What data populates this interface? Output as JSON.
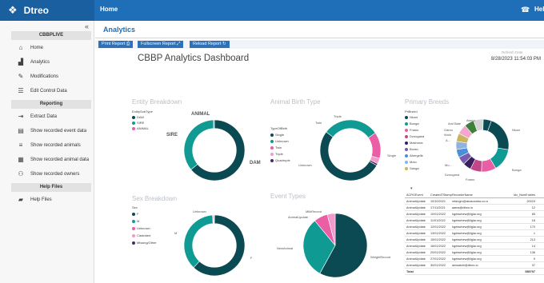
{
  "topbar": {
    "brand": "Dtreo",
    "home": "Home",
    "user": "Hel"
  },
  "sidebar": {
    "section1": "CBBPLIVE",
    "items1": [
      {
        "label": "Home",
        "icon": "home-icon"
      },
      {
        "label": "Analytics",
        "icon": "analytics-icon"
      },
      {
        "label": "Modifications",
        "icon": "edit-icon"
      },
      {
        "label": "Edit Control Data",
        "icon": "list-icon"
      }
    ],
    "section2": "Reporting",
    "items2": [
      {
        "label": "Extract Data",
        "icon": "extract-icon"
      },
      {
        "label": "Show recorded event data",
        "icon": "event-icon"
      },
      {
        "label": "Show recorded animals",
        "icon": "animals-icon"
      },
      {
        "label": "Show recorded animal data",
        "icon": "table-icon"
      },
      {
        "label": "Show recorded owners",
        "icon": "owners-icon"
      }
    ],
    "section3": "Help Files",
    "items3": [
      {
        "label": "Help Files",
        "icon": "folder-icon"
      }
    ]
  },
  "main": {
    "analytics": "Analytics",
    "buttons": [
      "Print Report",
      "Fullscreen Report",
      "Reload Report"
    ],
    "title": "CBBP Analytics Dashboard",
    "refresh_label": "Refresh Date",
    "refresh_date": "8/28/2023 11:54:03 PM"
  },
  "panels": {
    "entity": {
      "title": "Entity Breakdown",
      "legend_title": "EntitySubType",
      "legend": [
        "DAM",
        "SIRE",
        "ANIMAL"
      ],
      "labels": [
        "ANIMAL",
        "SIRE",
        "DAM"
      ],
      "colors": [
        "#0b4a52",
        "#0f9a94",
        "#ea5ea5"
      ]
    },
    "birth": {
      "title": "Animal Birth Type",
      "legend_title": "TypeOfBirth",
      "legend": [
        "Single",
        "Unknown",
        "Twin",
        "Triple",
        "Quadruple"
      ],
      "labels": [
        "Twin",
        "Triple",
        "Single",
        "Unknown"
      ],
      "colors": [
        "#0b4a52",
        "#0f9a94",
        "#ea5ea5",
        "#f29ac9",
        "#4a2a6a"
      ]
    },
    "breeds": {
      "title": "Primary Breeds",
      "legend_title": "PriBreed",
      "legend": [
        "Nkoni",
        "Bonga",
        "Fnanu",
        "Dzoogana",
        "Mashona",
        "Boran",
        "Abergelle",
        "Molo",
        "Sanga"
      ],
      "labels": [
        "Abera",
        "Arsi Bale",
        "Gamu",
        "Wolo",
        "A...",
        "Mo...",
        "Dzoogana",
        "Fnanu",
        "Bonga",
        "Nkoni"
      ],
      "colors": [
        "#0b4a52",
        "#0f9a94",
        "#ea5ea5",
        "#c2478a",
        "#3a1f5c",
        "#7b5bb0",
        "#4a90d9",
        "#8fb2e0",
        "#c9b65a",
        "#f2a7cf",
        "#3d7f3d",
        "#d4d4d4"
      ]
    },
    "sex": {
      "title": "Sex Breakdown",
      "legend_title": "Sex",
      "legend": [
        "F",
        "M",
        "Unknown",
        "Castrated",
        "Missing/Other"
      ],
      "labels": [
        "Unknown",
        "M",
        "F"
      ],
      "colors": [
        "#0b4a52",
        "#0f9a94",
        "#ea5ea5",
        "#f29ac9",
        "#4a2a6a"
      ]
    },
    "events": {
      "title": "Event Types",
      "labels": [
        "MilkRecord",
        "AnimalUpdate",
        "NewAnimal",
        "WeightRecord"
      ],
      "colors": [
        "#0b4a52",
        "#0f9a94",
        "#ea5ea5",
        "#f29ac9",
        "#4a2a6a",
        "#c9b65a"
      ]
    }
  },
  "table": {
    "headers": [
      "ACRGEvent",
      "CreatedTStamp",
      "RecorderName",
      "Idx_NumEntries"
    ],
    "rows": [
      [
        "AnimalUpdate",
        "10/10/2021",
        "mfangm@akasucaba.co.rz",
        "20023"
      ],
      [
        "AnimalUpdate",
        "17/11/2021",
        "aama@dtreo.io",
        "12"
      ],
      [
        "AnimalUpdate",
        "10/01/2022",
        "hgetachew@ilgiar.org",
        "65"
      ],
      [
        "AnimalUpdate",
        "11/01/2022",
        "hgetachew@ilgiar.org",
        "18"
      ],
      [
        "AnimalUpdate",
        "12/01/2022",
        "hgetachew@ilgiar.org",
        "170"
      ],
      [
        "AnimalUpdate",
        "13/01/2022",
        "hgetachew@ilgiar.org",
        "1"
      ],
      [
        "AnimalUpdate",
        "15/01/2022",
        "hgetachew@ilgiar.org",
        "213"
      ],
      [
        "AnimalUpdate",
        "16/01/2022",
        "hgetachew@ilgiar.org",
        "14"
      ],
      [
        "AnimalUpdate",
        "20/01/2022",
        "hgetachew@ilgiar.org",
        "136"
      ],
      [
        "AnimalUpdate",
        "27/01/2022",
        "hgetachew@ilgiar.org",
        "9"
      ],
      [
        "AnimalUpdate",
        "30/01/2022",
        "amwatchi@dtreo.io",
        "37"
      ]
    ],
    "total_label": "Total",
    "total_value": "585797"
  },
  "chart_data": [
    {
      "type": "pie",
      "title": "Entity Breakdown",
      "labels": [
        "DAM",
        "SIRE",
        "ANIMAL"
      ],
      "values": [
        64,
        35.5,
        0.5
      ]
    },
    {
      "type": "pie",
      "title": "Animal Birth Type",
      "labels": [
        "Single",
        "Unknown",
        "Twin",
        "Triple",
        "Quadruple"
      ],
      "values": [
        52,
        30,
        14,
        3,
        1
      ]
    },
    {
      "type": "pie",
      "title": "Primary Breeds",
      "labels": [
        "Nkoni",
        "Bonga",
        "Fnanu",
        "Dzoogana",
        "Mashona",
        "Boran",
        "Abergelle",
        "Mo...",
        "A...",
        "Wolo",
        "Gamu",
        "Arsi Bale",
        "Abera"
      ],
      "values": [
        22,
        14,
        9,
        7,
        5,
        5,
        5,
        5,
        5,
        6,
        6,
        6,
        5
      ]
    },
    {
      "type": "pie",
      "title": "Sex Breakdown",
      "labels": [
        "F",
        "M",
        "Unknown",
        "Castrated",
        "Missing/Other"
      ],
      "values": [
        62,
        37,
        0.5,
        0.3,
        0.2
      ]
    },
    {
      "type": "pie",
      "title": "Event Types",
      "labels": [
        "WeightRecord",
        "NewAnimal",
        "AnimalUpdate",
        "MilkRecord"
      ],
      "values": [
        58,
        31,
        7,
        4
      ]
    }
  ]
}
